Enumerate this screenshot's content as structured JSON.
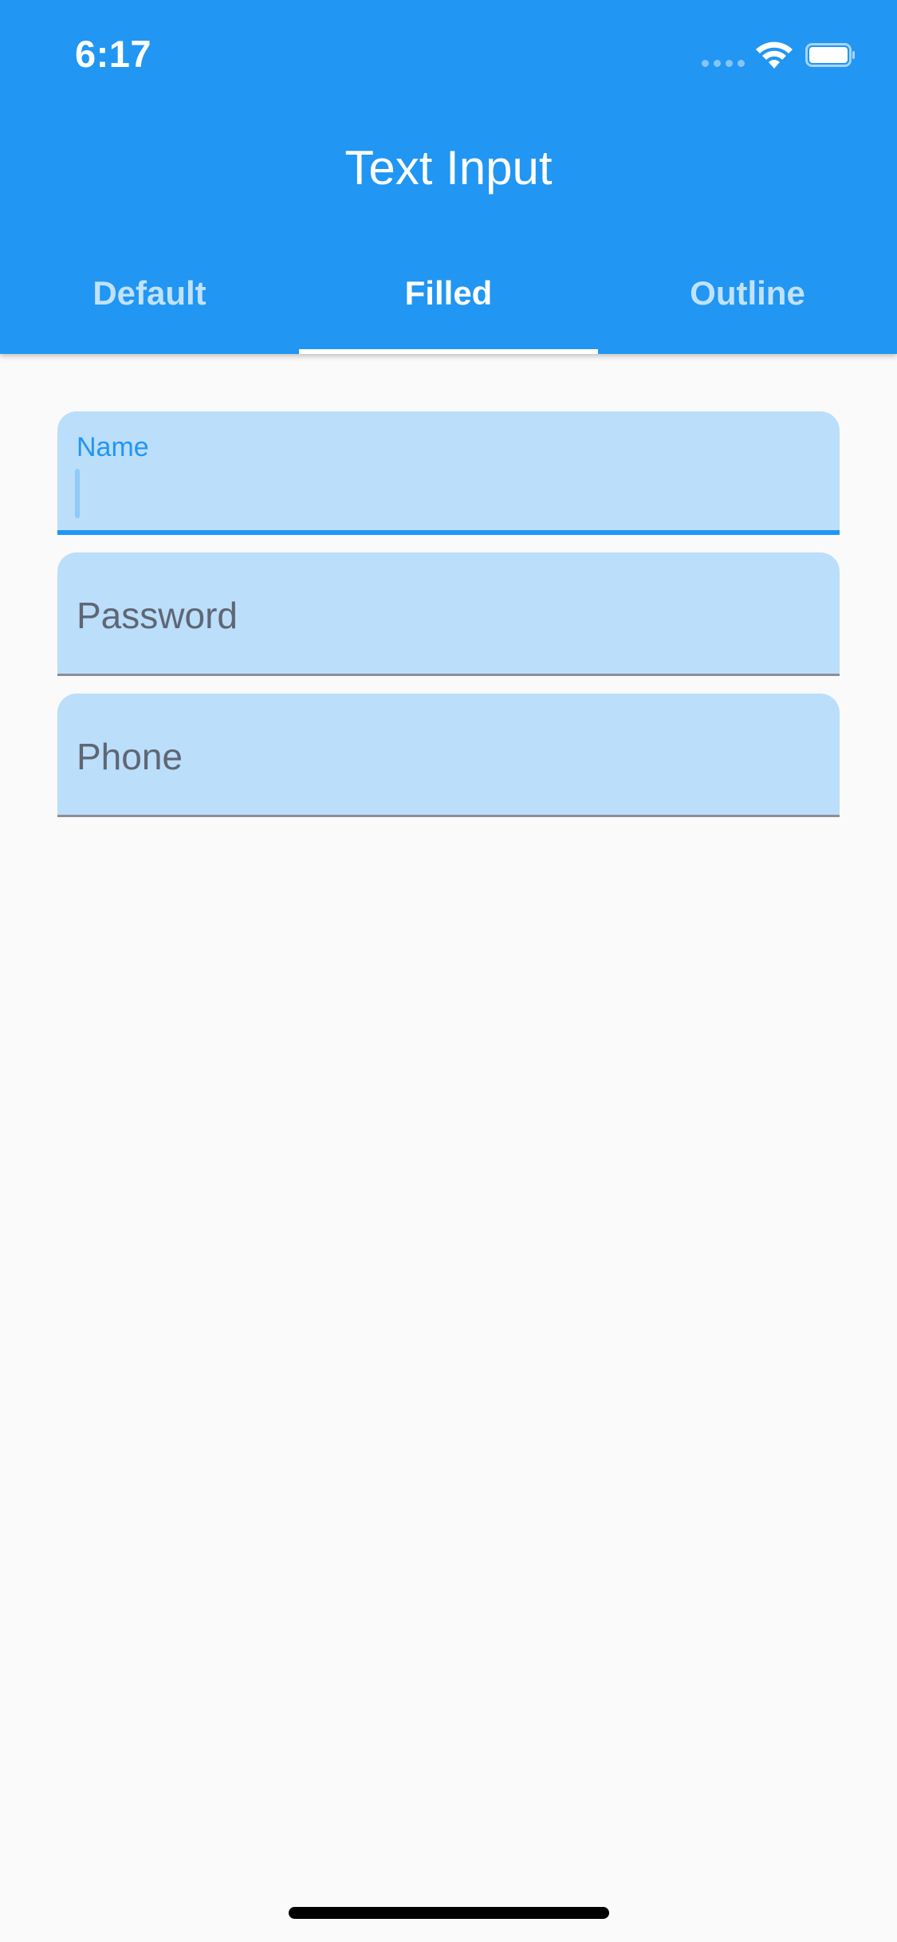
{
  "status_bar": {
    "time": "6:17"
  },
  "app_bar": {
    "title": "Text Input",
    "background": "#2196f3"
  },
  "tabs": [
    {
      "label": "Default",
      "active": false
    },
    {
      "label": "Filled",
      "active": true
    },
    {
      "label": "Outline",
      "active": false
    }
  ],
  "form": {
    "name_field": {
      "label": "Name",
      "value": ""
    },
    "password_field": {
      "placeholder": "Password",
      "value": ""
    },
    "phone_field": {
      "placeholder": "Phone",
      "value": ""
    }
  },
  "colors": {
    "accent": "#2196f3",
    "field_fill": "#bbdefb",
    "background": "#fafafa"
  },
  "icons": [
    "signal-icon",
    "wifi-icon",
    "battery-icon"
  ]
}
